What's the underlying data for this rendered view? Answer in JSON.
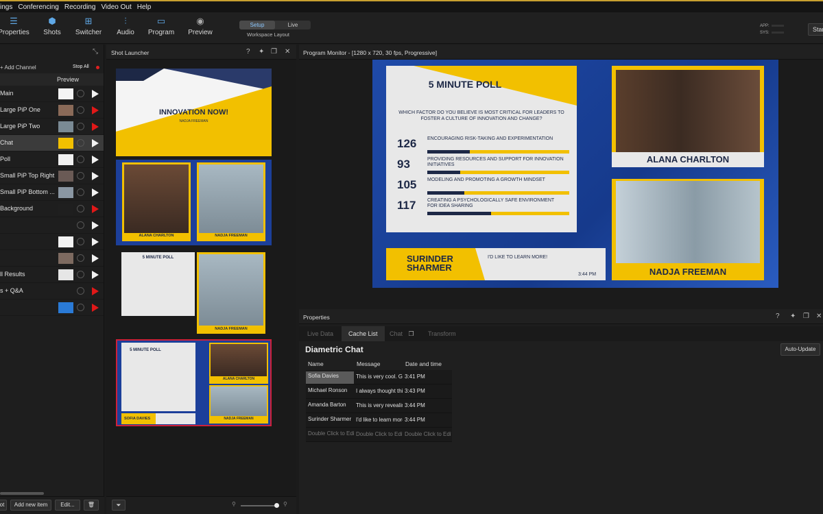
{
  "menu": [
    "ings",
    "Conferencing",
    "Recording",
    "Video Out",
    "Help"
  ],
  "toolbar": {
    "buttons": [
      {
        "label": "Properties",
        "icon": "list-icon"
      },
      {
        "label": "Shots",
        "icon": "cube-icon"
      },
      {
        "label": "Switcher",
        "icon": "switcher-icon"
      },
      {
        "label": "Audio",
        "icon": "audio-mixer-icon"
      },
      {
        "label": "Program",
        "icon": "monitor-icon"
      },
      {
        "label": "Preview",
        "icon": "eye-icon"
      }
    ],
    "workspace": {
      "setup": "Setup",
      "live": "Live",
      "label": "Workspace Layout"
    },
    "meters": {
      "app": "APP:",
      "sys": "SYS:"
    },
    "start": "Star"
  },
  "channels": {
    "add": "+ Add Channel",
    "stop_all": "Stop All",
    "preview_header": "Preview",
    "rows": [
      {
        "name": "Main",
        "live": false,
        "thumb": "#f4f4f4"
      },
      {
        "name": "Large PiP One",
        "live": true,
        "thumb": "#8a6a58"
      },
      {
        "name": "Large PiP Two",
        "live": true,
        "thumb": "#7a8a94"
      },
      {
        "name": "Chat",
        "live": false,
        "thumb": "#f2c000"
      },
      {
        "name": "Poll",
        "live": false,
        "thumb": "#f0f0f0"
      },
      {
        "name": "Small PiP Top Right",
        "live": false,
        "thumb": "#6a5a55"
      },
      {
        "name": "Small PiP Bottom ...",
        "live": false,
        "thumb": "#8a96a2"
      },
      {
        "name": "Background",
        "live": true,
        "thumb": "#1f1f1f"
      },
      {
        "name": "",
        "live": false,
        "thumb": "#1e1e1e"
      },
      {
        "name": "",
        "live": false,
        "thumb": "#f3f3f3"
      },
      {
        "name": "",
        "live": false,
        "thumb": "#7d6a60"
      },
      {
        "name": "ll Results",
        "live": false,
        "thumb": "#e6e6e6"
      },
      {
        "name": "s + Q&A",
        "live": true,
        "thumb": "#1e1e1e"
      },
      {
        "name": "",
        "live": true,
        "thumb": "#2a7ad6"
      }
    ],
    "footer": {
      "a": "ot",
      "add_item": "Add new item",
      "edit": "Edit..."
    }
  },
  "shot_launcher": {
    "title": "Shot Launcher",
    "shot1": {
      "headline": "INNOVATION NOW!",
      "sub": "NADJA FREEMAN"
    },
    "shot2": {
      "left": "ALANA CHARLTON",
      "right": "NADJA FREEMAN"
    },
    "shot3": {
      "poll": "5 MINUTE POLL",
      "right": "NADJA FREEMAN"
    },
    "shot4": {
      "poll": "5 MINUTE POLL",
      "top": "ALANA CHARLTON",
      "bottom": "NADJA FREEMAN",
      "chat_name": "SOFIA DAVIES"
    }
  },
  "monitor": {
    "title": "Program Monitor - [1280 x 720, 30 fps, Progressive]",
    "poll": {
      "title": "5 MINUTE POLL",
      "question": "WHICH FACTOR DO YOU BELIEVE IS MOST CRITICAL FOR LEADERS TO FOSTER A CULTURE OF INNOVATION AND CHANGE?",
      "items": [
        {
          "count": "126",
          "text": "ENCOURAGING RISK-TAKING AND EXPERIMENTATION",
          "fill": 0.3
        },
        {
          "count": "93",
          "text": "PROVIDING RESOURCES AND SUPPORT FOR INNOVATION INITIATIVES",
          "fill": 0.23
        },
        {
          "count": "105",
          "text": "MODELING AND PROMOTING A GROWTH MINDSET",
          "fill": 0.26
        },
        {
          "count": "117",
          "text": "CREATING A PSYCHOLOGICALLY SAFE ENVIRONMENT FOR IDEA SHARING",
          "fill": 0.45
        }
      ]
    },
    "speaker_top": "ALANA CHARLTON",
    "speaker_bottom": "NADJA FREEMAN",
    "chat": {
      "name_line1": "SURINDER",
      "name_line2": "SHARMER",
      "message": "I'D LIKE TO LEARN MORE!",
      "time": "3:44 PM"
    }
  },
  "properties": {
    "title": "Properties",
    "tabs": [
      "Live Data",
      "Cache List",
      "Chat",
      "Transform"
    ],
    "chat_title": "Diametric Chat",
    "auto_update": "Auto-Update",
    "columns": [
      "Name",
      "Message",
      "Date and time"
    ],
    "rows": [
      {
        "name": "Sofia Davies",
        "message": "This is very cool. Gr",
        "time": "3:41 PM"
      },
      {
        "name": "Michael Ronson",
        "message": "I always thought thi",
        "time": "3:43 PM"
      },
      {
        "name": "Amanda Barton",
        "message": "This is very revealin",
        "time": "3:44 PM"
      },
      {
        "name": "Surinder Sharmer",
        "message": "I'd like to learn more",
        "time": "3:44 PM"
      }
    ],
    "edit_row": {
      "name": "Double Click to Edit",
      "message": "Double Click to Edit",
      "time": "Double Click to Edit"
    }
  },
  "colors": {
    "accent_blue": "#5fa8e6",
    "live_red": "#e01818",
    "poll_yellow": "#f2c000",
    "navy": "#1d2846",
    "graphic_blue": "#1c3f9a"
  }
}
